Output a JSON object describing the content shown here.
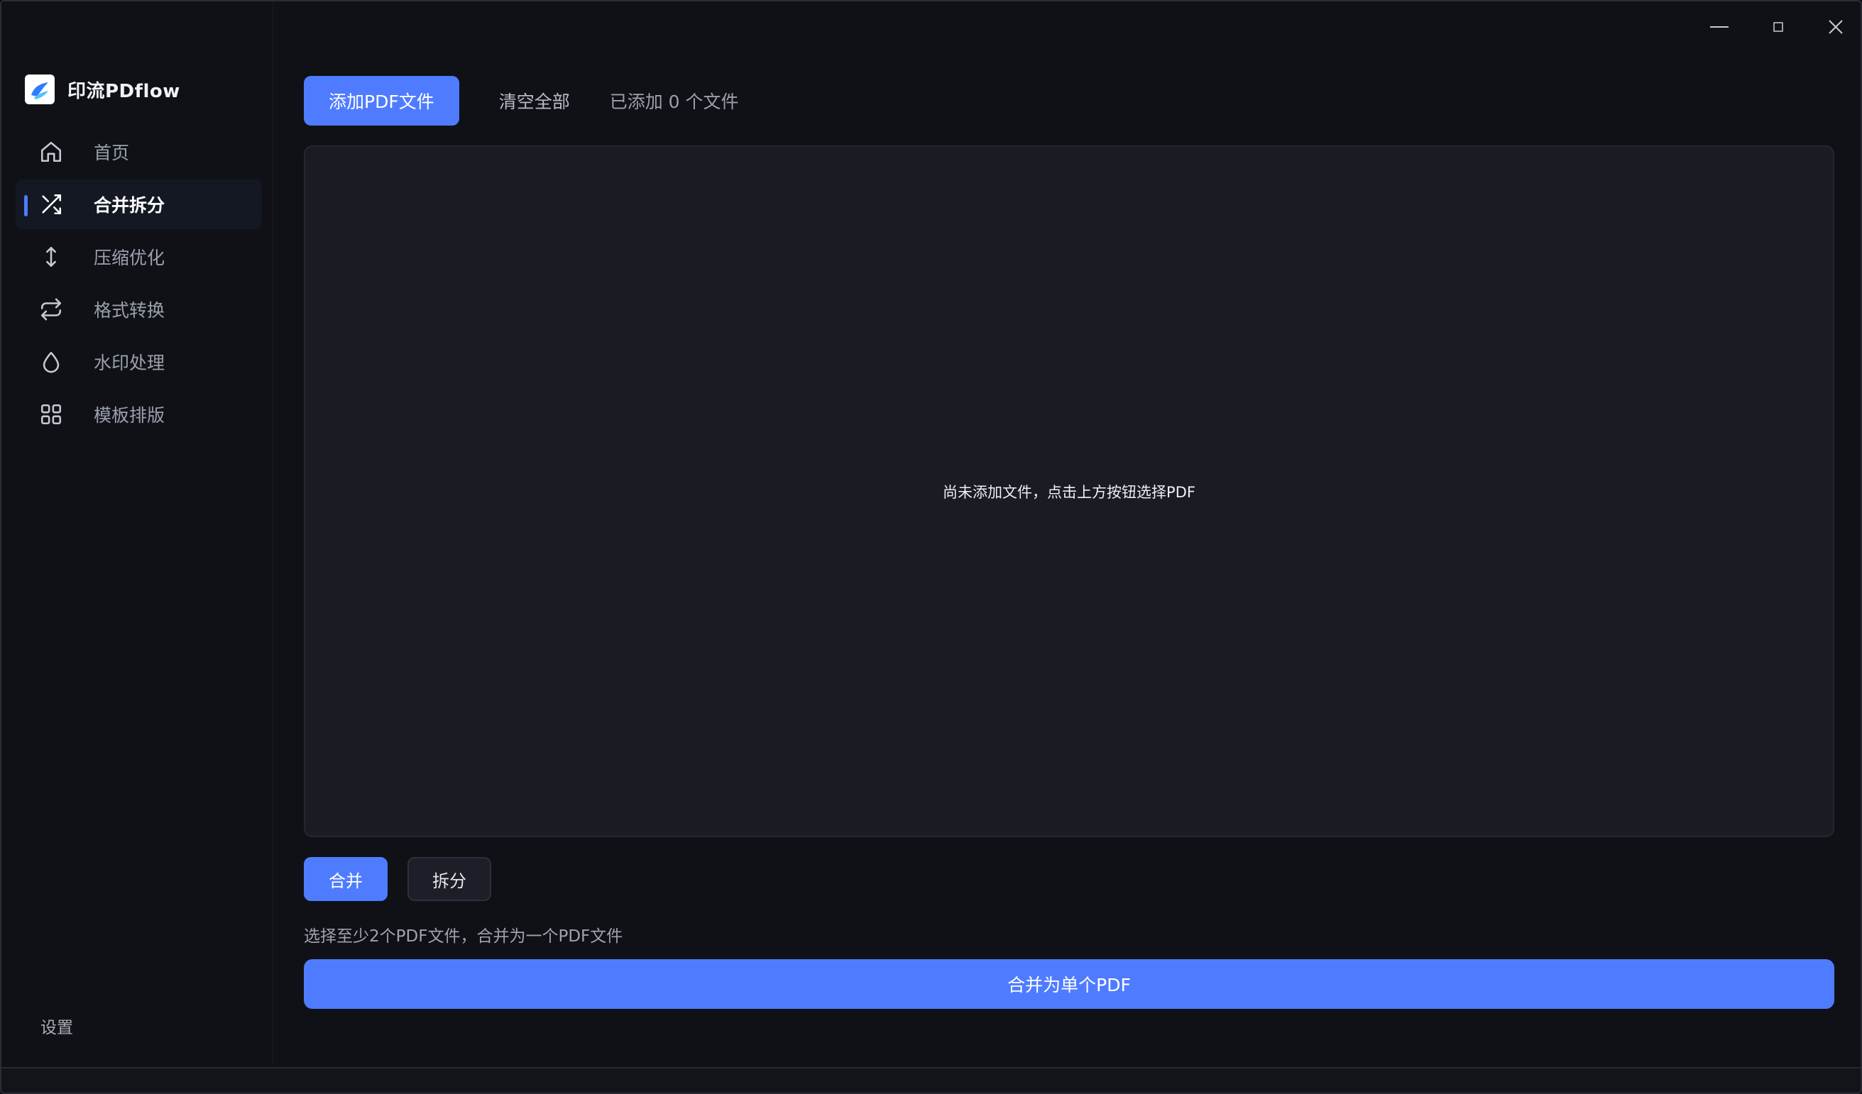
{
  "window": {
    "controls": {
      "minimize_icon": "minimize-icon",
      "maximize_icon": "maximize-icon",
      "close_icon": "close-icon"
    }
  },
  "sidebar": {
    "brand_name": "印流PDflow",
    "items": [
      {
        "label": "首页",
        "icon": "home-icon",
        "active": false
      },
      {
        "label": "合并拆分",
        "icon": "shuffle-icon",
        "active": true
      },
      {
        "label": "压缩优化",
        "icon": "vertical-arrows-icon",
        "active": false
      },
      {
        "label": "格式转换",
        "icon": "repeat-icon",
        "active": false
      },
      {
        "label": "水印处理",
        "icon": "droplet-icon",
        "active": false
      },
      {
        "label": "模板排版",
        "icon": "grid-icon",
        "active": false
      }
    ],
    "settings_label": "设置"
  },
  "main": {
    "toolbar": {
      "add_button": "添加PDF文件",
      "clear_button": "清空全部",
      "count_text": "已添加 0 个文件"
    },
    "dropzone": {
      "empty_text": "尚未添加文件，点击上方按钮选择PDF"
    },
    "mode_tabs": [
      {
        "label": "合并",
        "active": true
      },
      {
        "label": "拆分",
        "active": false
      }
    ],
    "hint": "选择至少2个PDF文件，合并为一个PDF文件",
    "action_button": "合并为单个PDF"
  },
  "colors": {
    "accent": "#4f7cff",
    "background": "#0f1116",
    "panel": "#1a1c24"
  }
}
